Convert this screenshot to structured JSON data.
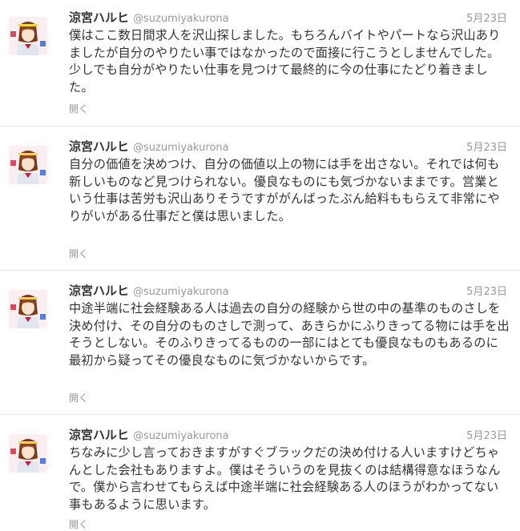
{
  "tweets": [
    {
      "name": "涼宮ハルヒ",
      "handle": "@suzumiyakurona",
      "time": "5月23日",
      "text": "僕はここ数日間求人を沢山探しました。もちろんバイトやパートなら沢山ありましたが自分のやりたい事ではなかったので面接に行こうとしませんでした。少しでも自分がやりたい仕事を見つけて最終的に今の仕事にたどり着きました。",
      "open": "開く"
    },
    {
      "name": "涼宮ハルヒ",
      "handle": "@suzumiyakurona",
      "time": "5月23日",
      "text": "自分の価値を決めつけ、自分の価値以上の物には手を出さない。それでは何も新しいものなど見つけられない。優良なものにも気づかないままです。営業という仕事は苦労も沢山ありそうですががんばったぶん給料ももらえて非常にやりがいがある仕事だと僕は思いました。",
      "open": "開く"
    },
    {
      "name": "涼宮ハルヒ",
      "handle": "@suzumiyakurona",
      "time": "5月23日",
      "text": "中途半端に社会経験ある人は過去の自分の経験から世の中の基準のものさしを決め付け、その自分のものさしで測って、あきらかにふりきってる物には手を出そうとしない。そのふりきってるものの一部にはとても優良なものもあるのに最初から疑ってその優良なものに気づかないからです。",
      "open": "開く"
    },
    {
      "name": "涼宮ハルヒ",
      "handle": "@suzumiyakurona",
      "time": "5月23日",
      "text": "ちなみに少し言っておきますがすぐブラックだの決め付ける人いますけどちゃんとした会社もありますよ。僕はそういうのを見抜くのは結構得意なほうなんで。僕から言わせてもらえば中途半端に社会経験ある人のほうがわかってない事もあるように思います。",
      "open": "開く"
    }
  ]
}
